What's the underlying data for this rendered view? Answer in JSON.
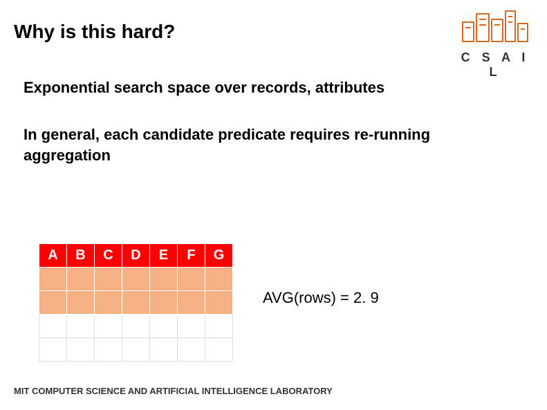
{
  "title": "Why is this hard?",
  "logo_label": "C S A I L",
  "body1": "Exponential search space over records, attributes",
  "body2": "In general, each candidate predicate requires re-running aggregation",
  "table": {
    "headers": [
      "A",
      "B",
      "C",
      "D",
      "E",
      "F",
      "G"
    ]
  },
  "avg": "AVG(rows) = 2. 9",
  "footer": "MIT COMPUTER SCIENCE AND ARTIFICIAL INTELLIGENCE LABORATORY"
}
